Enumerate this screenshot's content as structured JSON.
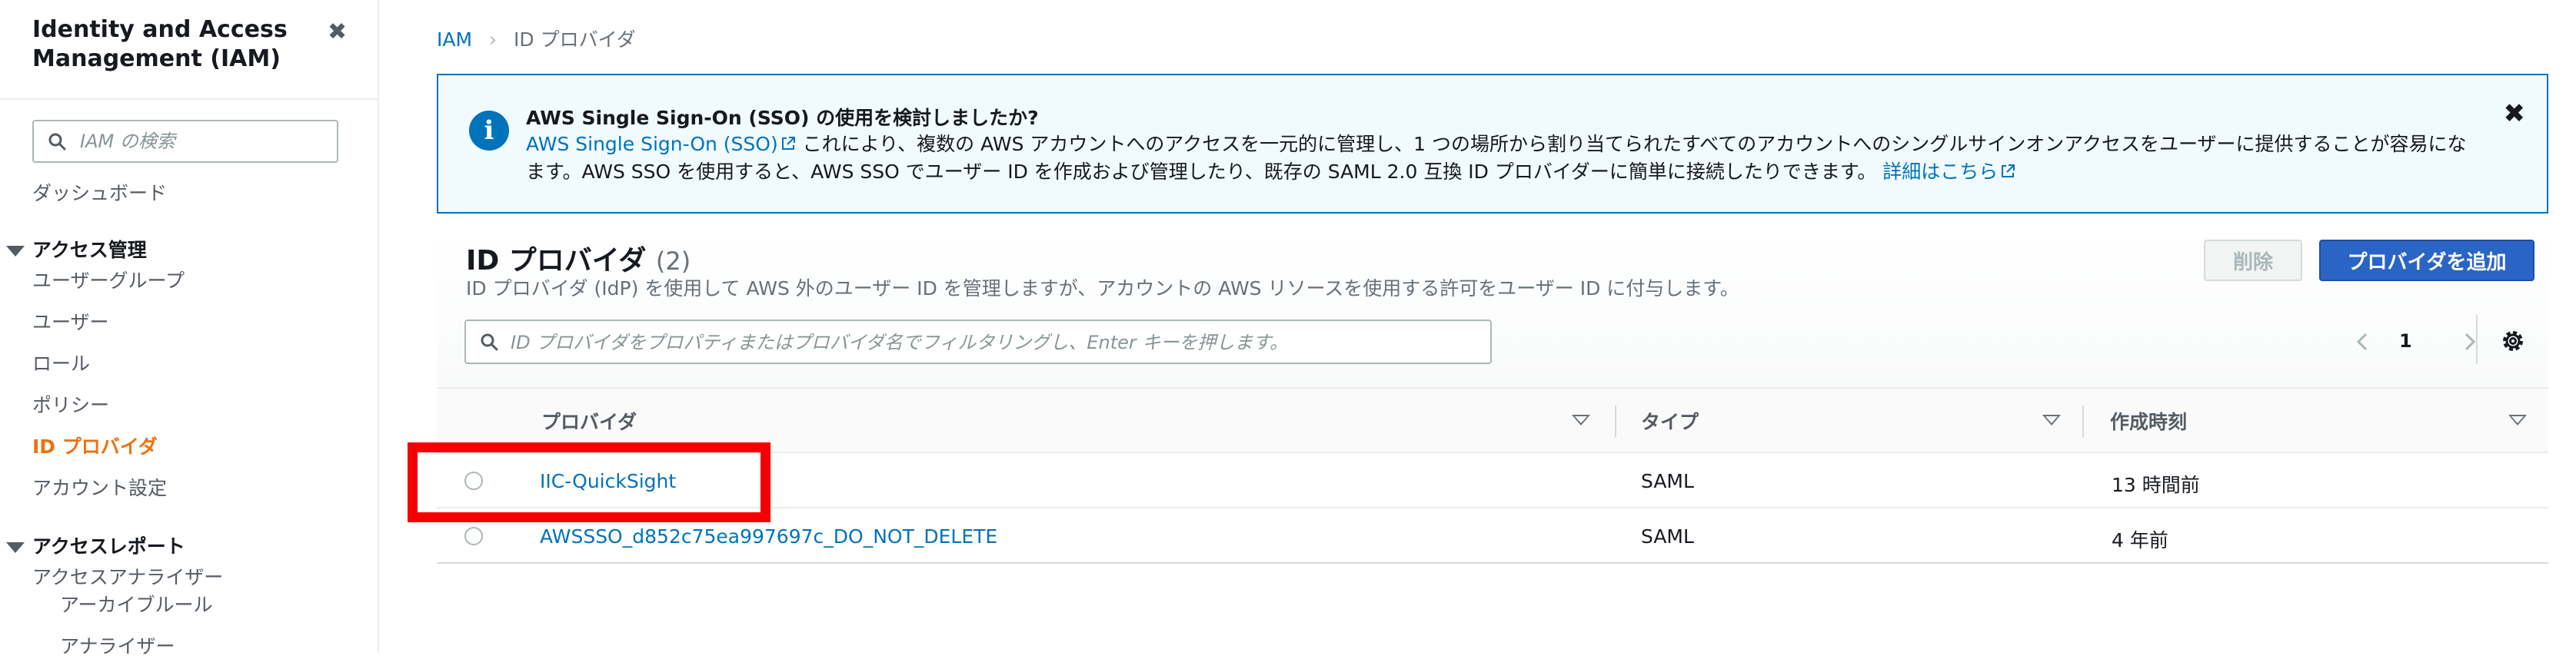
{
  "sidebar": {
    "title": "Identity and Access Management (IAM)",
    "close_icon": "close-icon",
    "search_placeholder": "IAM の検索",
    "dashboard": "ダッシュボード",
    "access_management": {
      "label": "アクセス管理",
      "items": [
        "ユーザーグループ",
        "ユーザー",
        "ロール",
        "ポリシー",
        "ID プロバイダ",
        "アカウント設定"
      ],
      "active_index": 4
    },
    "access_reports": {
      "label": "アクセスレポート",
      "analyzer": "アクセスアナライザー",
      "sub_items": [
        "アーカイブルール",
        "アナライザー"
      ]
    }
  },
  "breadcrumb": {
    "root": "IAM",
    "current": "ID プロバイダ"
  },
  "info": {
    "title": "AWS Single Sign-On (SSO) の使用を検討しましたか?",
    "link": "AWS Single Sign-On (SSO)",
    "body_line1": " これにより、複数の AWS アカウントへのアクセスを一元的に管理し、1 つの場所から割り当てられたすべてのアカウントへのシングルサインオンアクセスをユーザーに提供することが容易にな",
    "body_line2": "ます。AWS SSO を使用すると、AWS SSO でユーザー ID を作成および管理したり、既存の SAML 2.0 互換 ID プロバイダーに簡単に接続したりできます。",
    "more_link": "詳細はこちら"
  },
  "panel": {
    "title": "ID プロバイダ",
    "count": "(2)",
    "description": "ID プロバイダ (IdP) を使用して AWS 外のユーザー ID を管理しますが、アカウントの AWS リソースを使用する許可をユーザー ID に付与します。",
    "delete_label": "削除",
    "add_label": "プロバイダを追加",
    "filter_placeholder": "ID プロバイダをプロパティまたはプロバイダ名でフィルタリングし、Enter キーを押します。",
    "page": "1"
  },
  "table": {
    "headers": [
      "プロバイダ",
      "タイプ",
      "作成時刻"
    ],
    "rows": [
      {
        "provider": "IIC-QuickSight",
        "type": "SAML",
        "created": "13 時間前"
      },
      {
        "provider": "AWSSSO_d852c75ea997697c_DO_NOT_DELETE",
        "type": "SAML",
        "created": "4 年前"
      }
    ]
  },
  "colors": {
    "link": "#0073bb",
    "active_nav": "#ec7211",
    "primary_button": "#2a64c5",
    "highlight": "#f50000"
  }
}
